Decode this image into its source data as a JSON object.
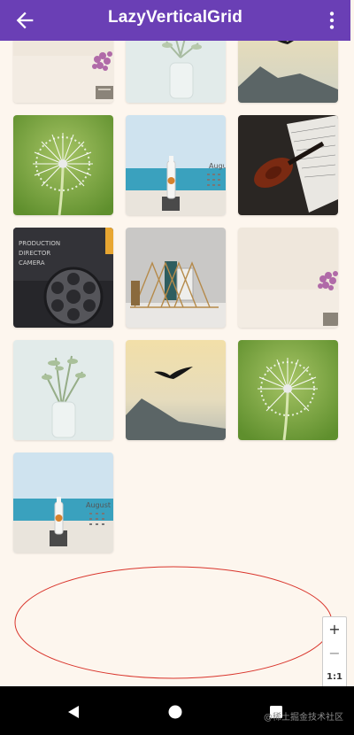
{
  "app_bar": {
    "title": "LazyVerticalGrid",
    "back_icon": "arrow-back-icon",
    "menu_icon": "more-vert-icon",
    "color": "#6a3fb5"
  },
  "grid": {
    "columns": 3,
    "tiles": [
      {
        "image": "lavender-still-life"
      },
      {
        "image": "plant-in-vase"
      },
      {
        "image": "flying-bird-over-mountains"
      },
      {
        "image": "dandelion"
      },
      {
        "image": "beach-bottle-calendar"
      },
      {
        "image": "violin-sheet-music"
      },
      {
        "image": "film-clapperboard-reel"
      },
      {
        "image": "wire-bookshelf"
      },
      {
        "image": "lavender-still-life"
      },
      {
        "image": "plant-in-vase"
      },
      {
        "image": "flying-bird-over-mountains"
      },
      {
        "image": "dandelion"
      },
      {
        "image": "beach-bottle-calendar"
      }
    ]
  },
  "clapperboard_text": [
    "PRODUCTION",
    "DIRECTOR",
    "CAMERA"
  ],
  "calendar_text": "August",
  "zoom_controls": {
    "zoom_in": "+",
    "zoom_out": "−",
    "reset": "1:1",
    "fit_icon": "fit-screen-icon"
  },
  "nav_bar": {
    "back_icon": "nav-back-icon",
    "home_icon": "nav-home-icon",
    "recents_icon": "nav-recents-icon"
  },
  "watermark": "@稀土掘金技术社区",
  "colors": {
    "background": "#fdf6ee",
    "annotation_ellipse": "#d9342b"
  }
}
